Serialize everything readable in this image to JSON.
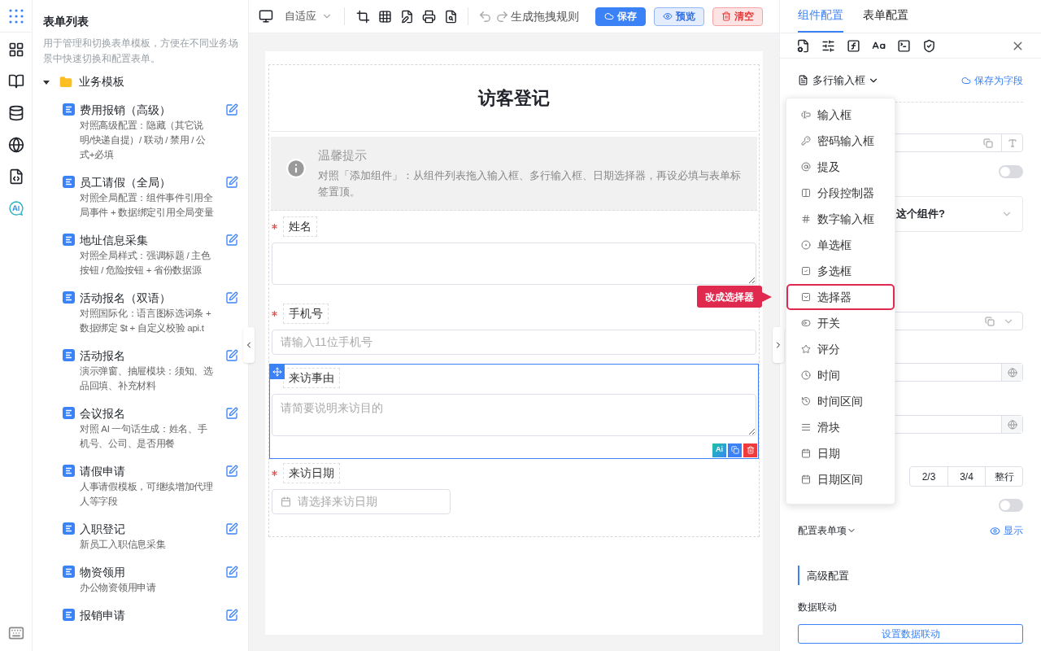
{
  "sidebar": {
    "title": "表单列表",
    "description": "用于管理和切换表单模板，方便在不同业务场景中快速切换和配置表单。",
    "folder": {
      "label": "业务模板",
      "expanded": true,
      "children": [
        {
          "title": "费用报销（高级）",
          "desc": "对照高级配置：隐藏（其它说明/快递自提）/ 联动 / 禁用 / 公式+必填"
        },
        {
          "title": "员工请假（全局）",
          "desc": "对照全局配置：组件事件引用全局事件 + 数据绑定引用全局变量"
        },
        {
          "title": "地址信息采集",
          "desc": "对照全局样式：强调标题 / 主色按钮 / 危险按钮 + 省份数据源"
        },
        {
          "title": "活动报名（双语）",
          "desc": "对照国际化：语言图标选词条 + 数据绑定 $t + 自定义校验 api.t"
        },
        {
          "title": "活动报名",
          "desc": "演示弹窗、抽屉模块：须知、选品回填、补充材料"
        },
        {
          "title": "会议报名",
          "desc": "对照 AI 一句话生成：姓名、手机号、公司、是否用餐"
        },
        {
          "title": "请假申请",
          "desc": "人事请假模板，可继续增加代理人等字段"
        },
        {
          "title": "入职登记",
          "desc": "新员工入职信息采集"
        },
        {
          "title": "物资领用",
          "desc": "办公物资领用申请"
        },
        {
          "title": "报销申请"
        }
      ]
    }
  },
  "toolbar": {
    "device": "自适应",
    "generate": "生成拖拽规则",
    "buttons": [
      {
        "kind": "primary",
        "label": "保存"
      },
      {
        "kind": "secondary",
        "label": "预览"
      },
      {
        "kind": "danger",
        "label": "清空"
      }
    ]
  },
  "form": {
    "title": "访客登记",
    "ai_button": "Ai",
    "notice": {
      "title": "温馨提示",
      "text": "对照「添加组件」：从组件列表拖入输入框、多行输入框、日期选择器，再设必填与表单标签置顶。"
    },
    "fields": [
      {
        "kind": "textarea",
        "label": "姓名",
        "required": true,
        "selected": false
      },
      {
        "kind": "input",
        "label": "手机号",
        "required": true,
        "selected": false,
        "placeholder": "请输入11位手机号"
      },
      {
        "kind": "textarea",
        "label": "来访事由",
        "required": false,
        "selected": true,
        "placeholder": "请简要说明来访目的"
      },
      {
        "kind": "date",
        "label": "来访日期",
        "required": true,
        "selected": false,
        "placeholder": "请选择来访日期"
      }
    ]
  },
  "panel": {
    "tabs": [
      {
        "label": "组件配置",
        "selected": true
      },
      {
        "label": "表单配置",
        "selected": false
      }
    ],
    "component_type": "多行输入框",
    "save_field": "保存为字段",
    "question": "这个组件?",
    "width_options": [
      "2/3",
      "3/4",
      "整行"
    ],
    "toggle_1": {
      "on": false
    },
    "toggle_2": {
      "on": false
    },
    "config_items": "配置表单项",
    "show": "显示",
    "advanced": "高级配置",
    "linkage_label": "数据联动",
    "linkage_button": "设置数据联动"
  },
  "menu": {
    "items": [
      {
        "label": "输入框",
        "selected": false
      },
      {
        "label": "密码输入框",
        "selected": false
      },
      {
        "label": "提及",
        "selected": false
      },
      {
        "label": "分段控制器",
        "selected": false
      },
      {
        "label": "数字输入框",
        "selected": false
      },
      {
        "label": "单选框",
        "selected": false
      },
      {
        "label": "多选框",
        "selected": false
      },
      {
        "label": "选择器",
        "selected": true
      },
      {
        "label": "开关",
        "selected": false
      },
      {
        "label": "评分",
        "selected": false
      },
      {
        "label": "时间",
        "selected": false
      },
      {
        "label": "时间区间",
        "selected": false
      },
      {
        "label": "滑块",
        "selected": false
      },
      {
        "label": "日期",
        "selected": false
      },
      {
        "label": "日期区间",
        "selected": false
      }
    ]
  },
  "callout": "改成选择器"
}
